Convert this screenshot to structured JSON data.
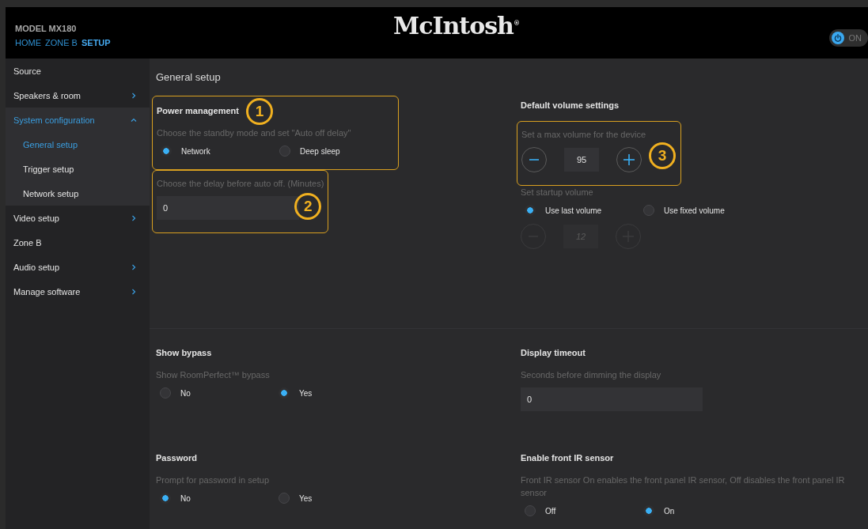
{
  "header": {
    "model": "MODEL MX180",
    "nav": [
      {
        "label": "HOME",
        "selected": false
      },
      {
        "label": "ZONE B",
        "selected": false
      },
      {
        "label": "SETUP",
        "selected": true
      }
    ],
    "logo": "McIntosh$^{®}$",
    "power": {
      "label": "ON",
      "on": true
    }
  },
  "sidebar": {
    "items": [
      {
        "label": "Source",
        "kind": "link",
        "selected": false
      },
      {
        "label": "Speakers & room",
        "kind": "folder",
        "expanded": false,
        "selected": false
      },
      {
        "label": "System configuration",
        "kind": "folder",
        "expanded": true,
        "selected": true,
        "children": [
          {
            "label": "General setup",
            "selected": true
          },
          {
            "label": "Trigger setup",
            "selected": false
          },
          {
            "label": "Network setup",
            "selected": false
          }
        ]
      },
      {
        "label": "Video setup",
        "kind": "folder",
        "expanded": false,
        "selected": false
      },
      {
        "label": "Zone B",
        "kind": "link",
        "selected": false
      },
      {
        "label": "Audio setup",
        "kind": "folder",
        "expanded": false,
        "selected": false
      },
      {
        "label": "Manage software",
        "kind": "folder",
        "expanded": false,
        "selected": false
      }
    ]
  },
  "page_title": "General setup",
  "sections": [
    {
      "groups": [
        {
          "blocks": [
            {
              "callout": "1",
              "items": [
                {
                  "kind": "heading",
                  "text": "Power management"
                },
                {
                  "kind": "radio",
                  "label": "Choose the standby mode and set \"Auto off delay\"",
                  "options": [
                    {
                      "label": "Network",
                      "selected": true
                    },
                    {
                      "label": "Deep sleep",
                      "selected": false
                    }
                  ]
                }
              ]
            },
            {
              "callout": "2",
              "items": [
                {
                  "kind": "input",
                  "label": "Choose the delay before auto off. (Minutes)",
                  "value": "0"
                }
              ]
            }
          ]
        },
        {
          "blocks": [
            {
              "items": [
                {
                  "kind": "heading",
                  "text": "Default volume settings"
                }
              ]
            },
            {
              "callout": "3",
              "items": [
                {
                  "kind": "stepper",
                  "label": "Set a max volume for the device",
                  "value": "95",
                  "disabled": false
                }
              ]
            },
            {
              "items": [
                {
                  "kind": "radio",
                  "label": "Set startup volume",
                  "options": [
                    {
                      "label": "Use last volume",
                      "selected": true
                    },
                    {
                      "label": "Use fixed volume",
                      "selected": false
                    }
                  ]
                },
                {
                  "kind": "stepper",
                  "value": "12",
                  "disabled": true
                }
              ]
            }
          ]
        }
      ]
    },
    {
      "groups": [
        {
          "blocks": [
            {
              "items": [
                {
                  "kind": "heading",
                  "text": "Show bypass"
                },
                {
                  "kind": "radio",
                  "label": "Show RoomPerfect™ bypass",
                  "options": [
                    {
                      "label": "No",
                      "selected": false
                    },
                    {
                      "label": "Yes",
                      "selected": true
                    }
                  ]
                }
              ]
            }
          ]
        },
        {
          "blocks": [
            {
              "items": [
                {
                  "kind": "heading",
                  "text": "Display timeout"
                },
                {
                  "kind": "input",
                  "label": "Seconds before dimming the display",
                  "value": "0"
                }
              ]
            }
          ]
        },
        {
          "blocks": [
            {
              "items": [
                {
                  "kind": "heading",
                  "text": "Password"
                },
                {
                  "kind": "radio",
                  "label": "Prompt for password in setup",
                  "options": [
                    {
                      "label": "No",
                      "selected": true
                    },
                    {
                      "label": "Yes",
                      "selected": false
                    }
                  ]
                }
              ]
            }
          ]
        },
        {
          "blocks": [
            {
              "items": [
                {
                  "kind": "heading",
                  "text": "Enable front IR sensor"
                },
                {
                  "kind": "radio",
                  "label": "Front IR sensor On enables the front panel IR sensor, Off disables the front panel IR sensor",
                  "options": [
                    {
                      "label": "Off",
                      "selected": false
                    },
                    {
                      "label": "On",
                      "selected": true
                    }
                  ]
                }
              ]
            }
          ]
        }
      ]
    }
  ]
}
